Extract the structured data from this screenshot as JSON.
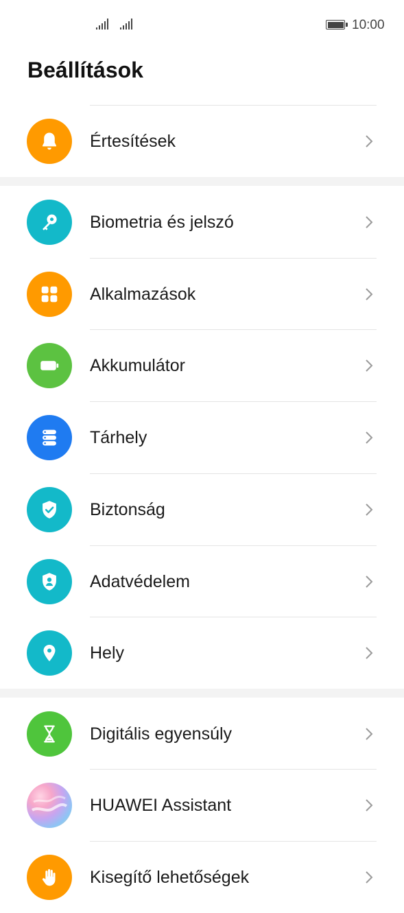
{
  "status_bar": {
    "time": "10:00",
    "battery_level": 1.0
  },
  "header": {
    "title": "Beállítások"
  },
  "settings": {
    "items": [
      {
        "label": "Értesítések",
        "icon": "bell-icon",
        "color": "#FF9A00"
      },
      {
        "label": "Biometria és jelszó",
        "icon": "key-icon",
        "color": "#13B9C9"
      },
      {
        "label": "Alkalmazások",
        "icon": "apps-grid-icon",
        "color": "#FF9A00"
      },
      {
        "label": "Akkumulátor",
        "icon": "battery-icon",
        "color": "#5CC241"
      },
      {
        "label": "Tárhely",
        "icon": "storage-icon",
        "color": "#1F7BF1"
      },
      {
        "label": "Biztonság",
        "icon": "shield-check-icon",
        "color": "#13B9C9"
      },
      {
        "label": "Adatvédelem",
        "icon": "privacy-shield-icon",
        "color": "#13B9C9"
      },
      {
        "label": "Hely",
        "icon": "location-pin-icon",
        "color": "#13B9C9"
      },
      {
        "label": "Digitális egyensúly",
        "icon": "hourglass-icon",
        "color": "#4FC53C"
      },
      {
        "label": "HUAWEI Assistant",
        "icon": "assistant-orb-icon",
        "color": "#B59BE8"
      },
      {
        "label": "Kisegítő lehetőségek",
        "icon": "hand-icon",
        "color": "#FF9A00"
      }
    ]
  }
}
